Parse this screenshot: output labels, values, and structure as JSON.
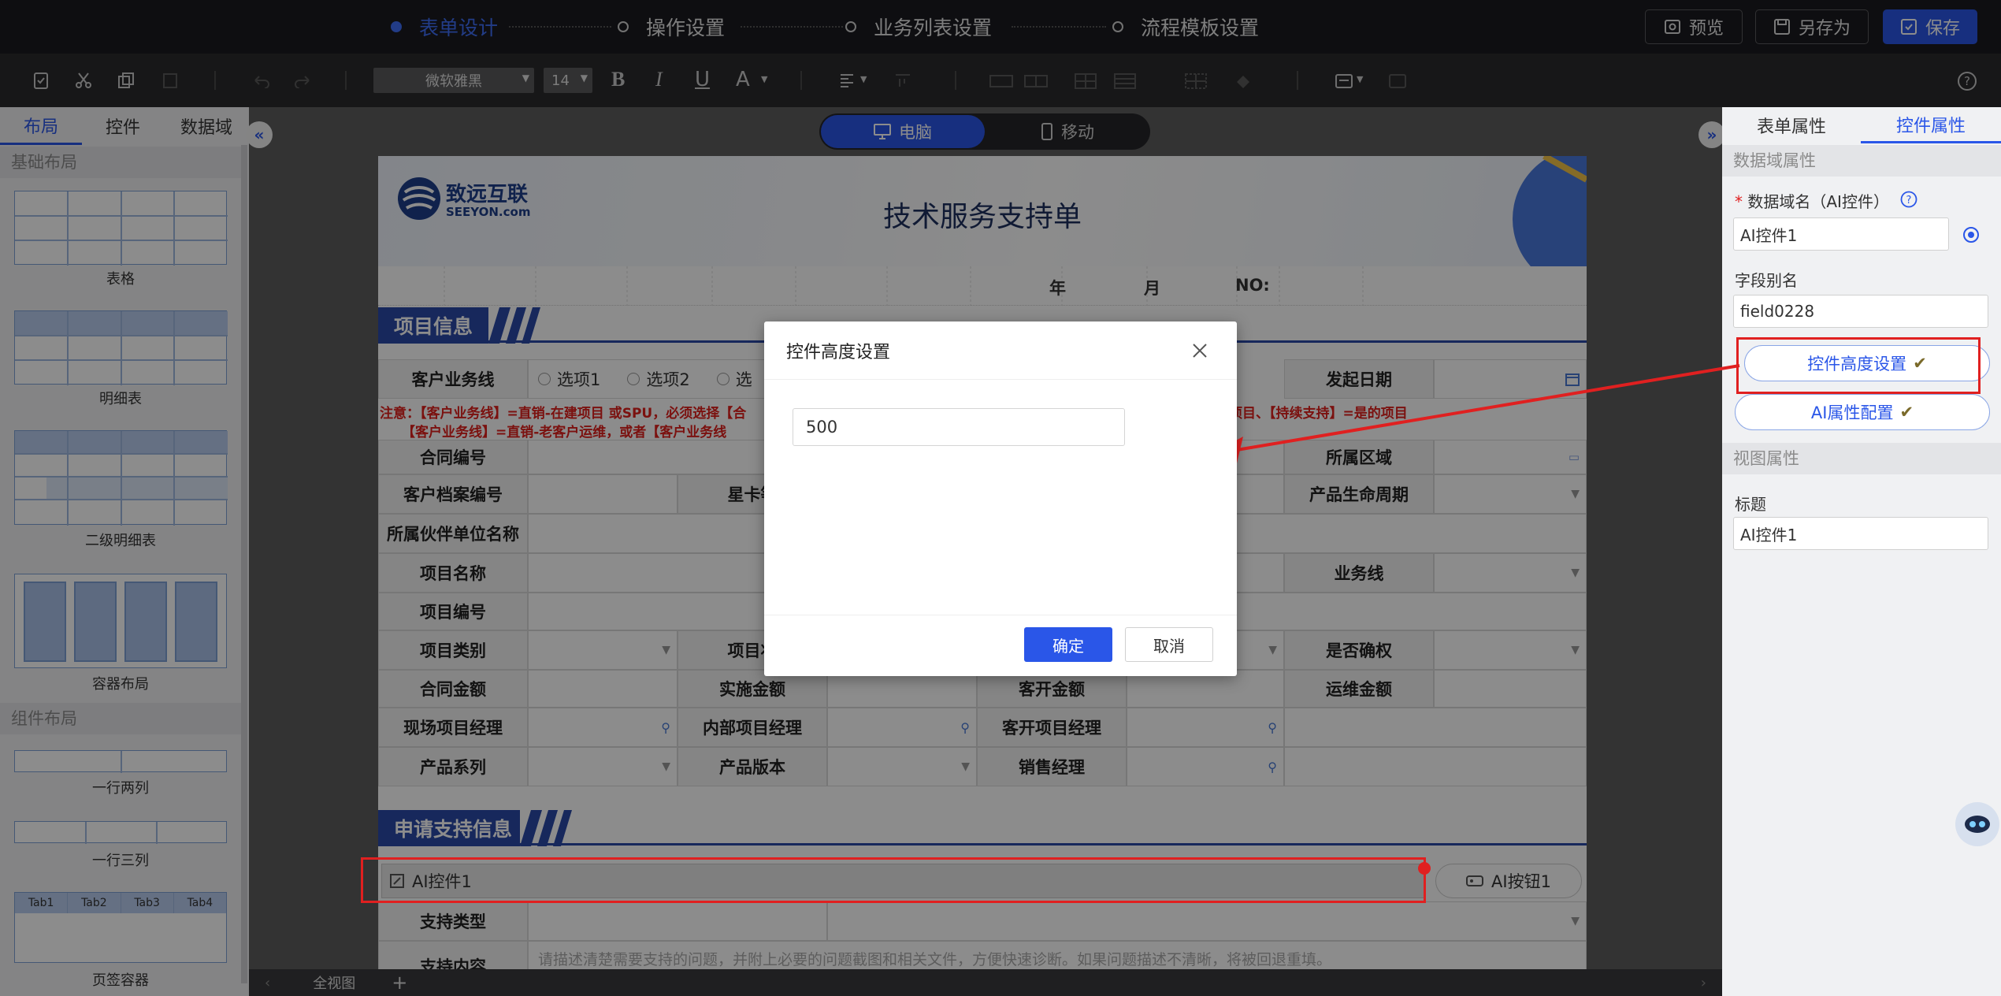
{
  "topnav": {
    "steps": [
      {
        "label": "表单设计",
        "active": true
      },
      {
        "label": "操作设置",
        "active": false
      },
      {
        "label": "业务列表设置",
        "active": false
      },
      {
        "label": "流程模板设置",
        "active": false
      }
    ],
    "preview_label": "预览",
    "saveas_label": "另存为",
    "save_label": "保存",
    "accent_color": "#2a56e8"
  },
  "toolbar": {
    "font_family_value": "微软雅黑",
    "font_size_value": "14",
    "bold_label": "B",
    "italic_label": "I",
    "underline_label": "U",
    "font_color_label": "A"
  },
  "left_panel": {
    "tabs": [
      "布局",
      "控件",
      "数据域"
    ],
    "active_tab": "布局",
    "section_basic": "基础布局",
    "basic_items": [
      "表格",
      "明细表",
      "二级明细表",
      "容器布局"
    ],
    "section_component": "组件布局",
    "component_items": [
      "一行两列",
      "一行三列",
      "页签容器"
    ],
    "tab_thumb_labels": [
      "Tab1",
      "Tab2",
      "Tab3",
      "Tab4"
    ]
  },
  "canvas": {
    "view_toggle": {
      "desktop": "电脑",
      "mobile": "移动",
      "active": "电脑"
    },
    "bottom_bar": {
      "overview_label": "全视图",
      "add_label": "+"
    }
  },
  "form": {
    "logo_cn": "致远互联",
    "logo_en": "SEEYON.com",
    "title": "技术服务支持单",
    "date_row": {
      "year": "年",
      "month": "月",
      "no": "NO:"
    },
    "section1_title": "项目信息",
    "customer_line_label": "客户业务线",
    "options": [
      "选项1",
      "选项2",
      "选"
    ],
    "start_date_label": "发起日期",
    "note_line1_left": "注意：【客户业务线】=直销-在建项目 或SPU，必须选择【合",
    "note_line1_right": "项目、【持续支持】=是的项目",
    "note_line2_left": "【客户业务线】=直销-老客户运维，或者【客户业务线",
    "labels": {
      "contract_no": "合同编号",
      "region": "所属区域",
      "customer_file_no": "客户档案编号",
      "star_level": "星卡等",
      "product_lifecycle": "产品生命周期",
      "partner_unit": "所属伙伴单位名称",
      "project_name": "项目名称",
      "business_line": "业务线",
      "project_no": "项目编号",
      "project_type": "项目类别",
      "project_status": "项目状",
      "is_confirmed": "是否确权",
      "contract_amount": "合同金额",
      "impl_amount": "实施金额",
      "kekai_amount": "客开金额",
      "maintenance_amount": "运维金额",
      "site_pm": "现场项目经理",
      "internal_pm": "内部项目经理",
      "kekai_pm": "客开项目经理",
      "product_series": "产品系列",
      "product_version": "产品版本",
      "sales_manager": "销售经理"
    },
    "section2_title": "申请支持信息",
    "ai_control_label": "AI控件1",
    "ai_button_label": "AI按钮1",
    "support_type_label": "支持类型",
    "support_content_label": "支持内容",
    "support_content_placeholder": "请描述清楚需要支持的问题，并附上必要的问题截图和相关文件，方便快速诊断。如果问题描述不清晰，将被回退重填。"
  },
  "right_panel": {
    "tabs": [
      "表单属性",
      "控件属性"
    ],
    "active_tab": "控件属性",
    "section_data": "数据域属性",
    "data_name_label": "数据域名（AI控件）",
    "data_name_value": "AI控件1",
    "alias_label": "字段别名",
    "alias_value": "field0228",
    "height_btn_label": "控件高度设置",
    "ai_config_btn_label": "AI属性配置",
    "section_view": "视图属性",
    "title_label": "标题",
    "title_value": "AI控件1"
  },
  "dialog": {
    "title": "控件高度设置",
    "input_value": "500",
    "confirm_label": "确定",
    "cancel_label": "取消"
  },
  "annotation_color": "#e02020"
}
